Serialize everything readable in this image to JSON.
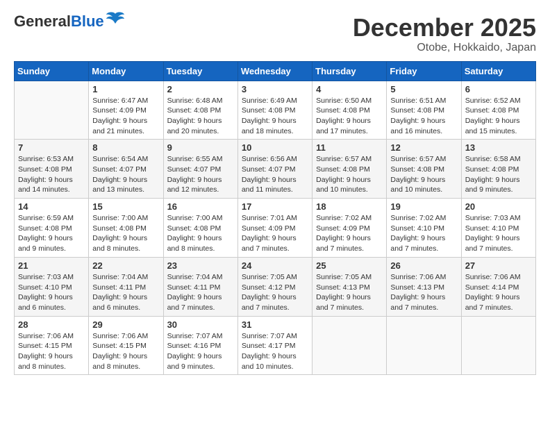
{
  "logo": {
    "general": "General",
    "blue": "Blue"
  },
  "title": {
    "month_year": "December 2025",
    "location": "Otobe, Hokkaido, Japan"
  },
  "weekdays": [
    "Sunday",
    "Monday",
    "Tuesday",
    "Wednesday",
    "Thursday",
    "Friday",
    "Saturday"
  ],
  "weeks": [
    [
      {
        "day": null,
        "info": null
      },
      {
        "day": "1",
        "info": "Sunrise: 6:47 AM\nSunset: 4:09 PM\nDaylight: 9 hours\nand 21 minutes."
      },
      {
        "day": "2",
        "info": "Sunrise: 6:48 AM\nSunset: 4:08 PM\nDaylight: 9 hours\nand 20 minutes."
      },
      {
        "day": "3",
        "info": "Sunrise: 6:49 AM\nSunset: 4:08 PM\nDaylight: 9 hours\nand 18 minutes."
      },
      {
        "day": "4",
        "info": "Sunrise: 6:50 AM\nSunset: 4:08 PM\nDaylight: 9 hours\nand 17 minutes."
      },
      {
        "day": "5",
        "info": "Sunrise: 6:51 AM\nSunset: 4:08 PM\nDaylight: 9 hours\nand 16 minutes."
      },
      {
        "day": "6",
        "info": "Sunrise: 6:52 AM\nSunset: 4:08 PM\nDaylight: 9 hours\nand 15 minutes."
      }
    ],
    [
      {
        "day": "7",
        "info": "Sunrise: 6:53 AM\nSunset: 4:08 PM\nDaylight: 9 hours\nand 14 minutes."
      },
      {
        "day": "8",
        "info": "Sunrise: 6:54 AM\nSunset: 4:07 PM\nDaylight: 9 hours\nand 13 minutes."
      },
      {
        "day": "9",
        "info": "Sunrise: 6:55 AM\nSunset: 4:07 PM\nDaylight: 9 hours\nand 12 minutes."
      },
      {
        "day": "10",
        "info": "Sunrise: 6:56 AM\nSunset: 4:07 PM\nDaylight: 9 hours\nand 11 minutes."
      },
      {
        "day": "11",
        "info": "Sunrise: 6:57 AM\nSunset: 4:08 PM\nDaylight: 9 hours\nand 10 minutes."
      },
      {
        "day": "12",
        "info": "Sunrise: 6:57 AM\nSunset: 4:08 PM\nDaylight: 9 hours\nand 10 minutes."
      },
      {
        "day": "13",
        "info": "Sunrise: 6:58 AM\nSunset: 4:08 PM\nDaylight: 9 hours\nand 9 minutes."
      }
    ],
    [
      {
        "day": "14",
        "info": "Sunrise: 6:59 AM\nSunset: 4:08 PM\nDaylight: 9 hours\nand 9 minutes."
      },
      {
        "day": "15",
        "info": "Sunrise: 7:00 AM\nSunset: 4:08 PM\nDaylight: 9 hours\nand 8 minutes."
      },
      {
        "day": "16",
        "info": "Sunrise: 7:00 AM\nSunset: 4:08 PM\nDaylight: 9 hours\nand 8 minutes."
      },
      {
        "day": "17",
        "info": "Sunrise: 7:01 AM\nSunset: 4:09 PM\nDaylight: 9 hours\nand 7 minutes."
      },
      {
        "day": "18",
        "info": "Sunrise: 7:02 AM\nSunset: 4:09 PM\nDaylight: 9 hours\nand 7 minutes."
      },
      {
        "day": "19",
        "info": "Sunrise: 7:02 AM\nSunset: 4:10 PM\nDaylight: 9 hours\nand 7 minutes."
      },
      {
        "day": "20",
        "info": "Sunrise: 7:03 AM\nSunset: 4:10 PM\nDaylight: 9 hours\nand 7 minutes."
      }
    ],
    [
      {
        "day": "21",
        "info": "Sunrise: 7:03 AM\nSunset: 4:10 PM\nDaylight: 9 hours\nand 6 minutes."
      },
      {
        "day": "22",
        "info": "Sunrise: 7:04 AM\nSunset: 4:11 PM\nDaylight: 9 hours\nand 6 minutes."
      },
      {
        "day": "23",
        "info": "Sunrise: 7:04 AM\nSunset: 4:11 PM\nDaylight: 9 hours\nand 7 minutes."
      },
      {
        "day": "24",
        "info": "Sunrise: 7:05 AM\nSunset: 4:12 PM\nDaylight: 9 hours\nand 7 minutes."
      },
      {
        "day": "25",
        "info": "Sunrise: 7:05 AM\nSunset: 4:13 PM\nDaylight: 9 hours\nand 7 minutes."
      },
      {
        "day": "26",
        "info": "Sunrise: 7:06 AM\nSunset: 4:13 PM\nDaylight: 9 hours\nand 7 minutes."
      },
      {
        "day": "27",
        "info": "Sunrise: 7:06 AM\nSunset: 4:14 PM\nDaylight: 9 hours\nand 7 minutes."
      }
    ],
    [
      {
        "day": "28",
        "info": "Sunrise: 7:06 AM\nSunset: 4:15 PM\nDaylight: 9 hours\nand 8 minutes."
      },
      {
        "day": "29",
        "info": "Sunrise: 7:06 AM\nSunset: 4:15 PM\nDaylight: 9 hours\nand 8 minutes."
      },
      {
        "day": "30",
        "info": "Sunrise: 7:07 AM\nSunset: 4:16 PM\nDaylight: 9 hours\nand 9 minutes."
      },
      {
        "day": "31",
        "info": "Sunrise: 7:07 AM\nSunset: 4:17 PM\nDaylight: 9 hours\nand 10 minutes."
      },
      {
        "day": null,
        "info": null
      },
      {
        "day": null,
        "info": null
      },
      {
        "day": null,
        "info": null
      }
    ]
  ]
}
